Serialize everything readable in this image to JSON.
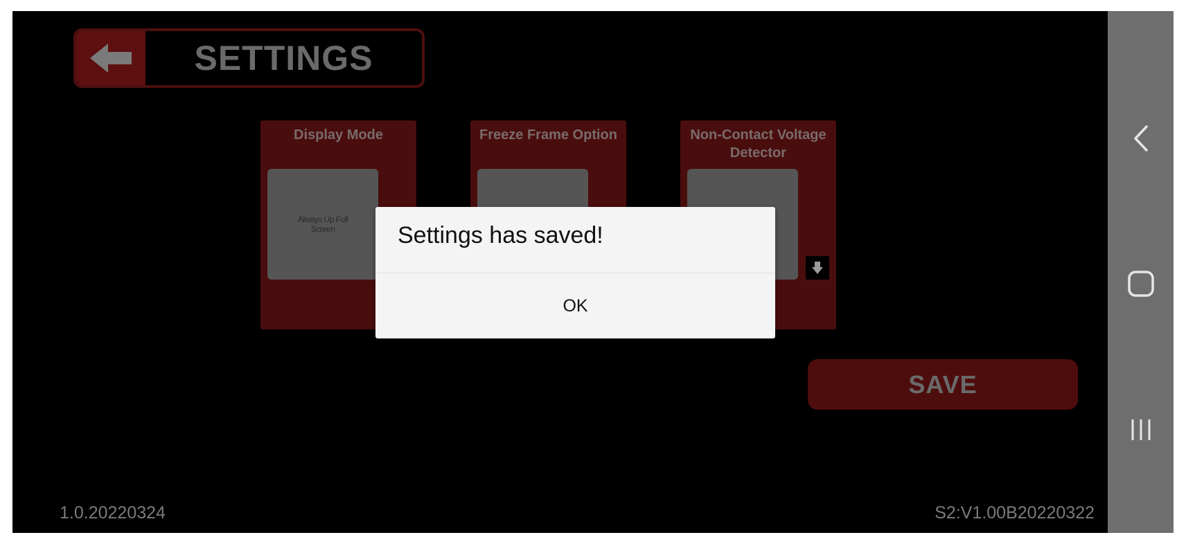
{
  "header": {
    "title": "SETTINGS",
    "back_icon": "arrow-left-icon"
  },
  "cards": [
    {
      "title": "Display Mode",
      "preview_text": "Always Up Full Screen"
    },
    {
      "title": "Freeze Frame Option",
      "preview_text": ""
    },
    {
      "title": "Non-Contact Voltage Detector",
      "preview_text": "",
      "dropdown_icon": "arrow-down-icon"
    }
  ],
  "save_label": "SAVE",
  "versions": {
    "left": "1.0.20220324",
    "right": "S2:V1.00B20220322"
  },
  "dialog": {
    "message": "Settings has saved!",
    "ok_label": "OK"
  },
  "navbar": {
    "back_icon": "chevron-left-icon",
    "home_icon": "home-square-icon",
    "recents_icon": "recents-bars-icon"
  },
  "colors": {
    "accent_dark_red": "#4a0d0d",
    "background": "#000000",
    "dialog_bg": "#f4f4f4",
    "navbar_bg": "#6e6e6e"
  }
}
